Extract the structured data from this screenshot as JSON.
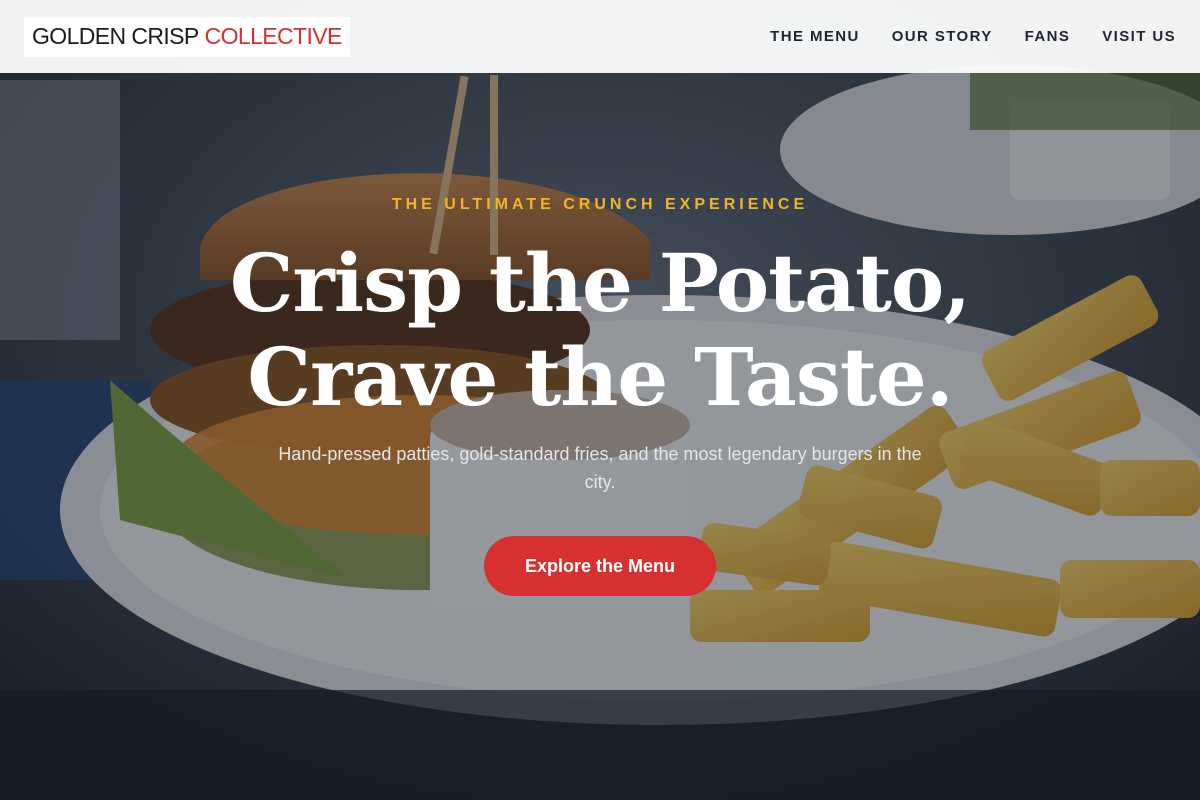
{
  "navbar": {
    "brand": {
      "main": "GOLDEN CRISP",
      "accent": "COLLECTIVE"
    },
    "links": [
      {
        "label": "THE MENU"
      },
      {
        "label": "OUR STORY"
      },
      {
        "label": "FANS"
      },
      {
        "label": "VISIT US"
      }
    ]
  },
  "hero": {
    "tagline": "THE ULTIMATE CRUNCH EXPERIENCE",
    "headline_line1": "Crisp the Potato,",
    "headline_line2": "Crave the Taste.",
    "subtext": "Hand-pressed patties, gold-standard fries, and the most legendary burgers in the city.",
    "cta_label": "Explore the Menu",
    "background_image": "burger-and-fries-photo"
  },
  "colors": {
    "accent_red": "#d63031",
    "tagline_gold": "#f3b429",
    "nav_text": "#1e2530"
  }
}
